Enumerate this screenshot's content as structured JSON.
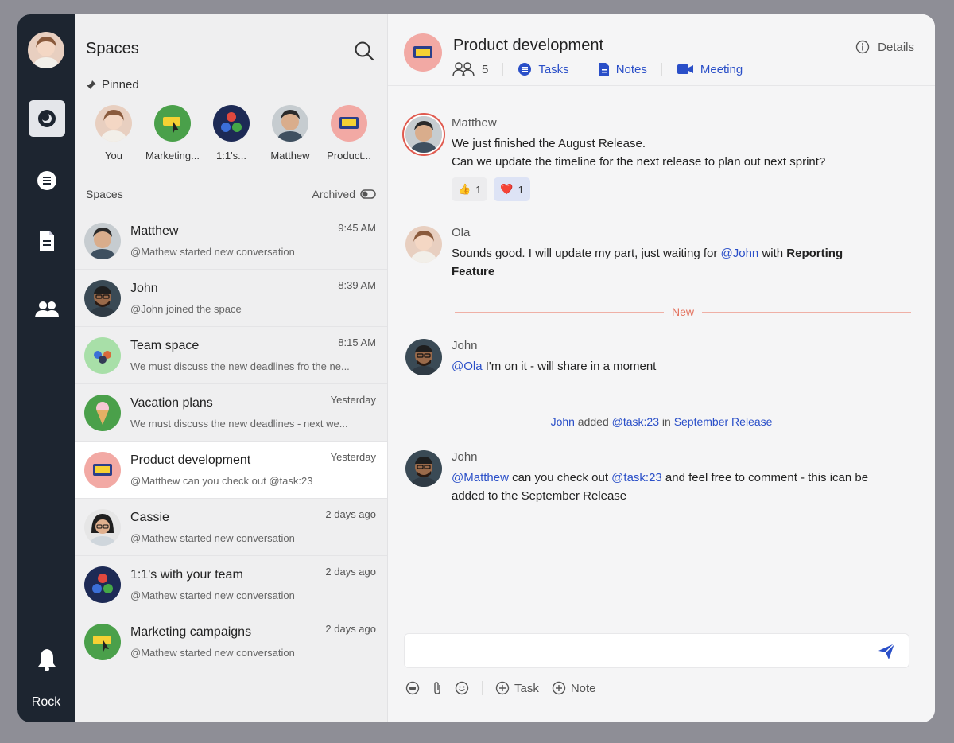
{
  "rail": {
    "label": "Rock",
    "icons": [
      "chat-bubble-icon",
      "tasks-list-icon",
      "notes-document-icon",
      "team-people-icon",
      "bell-icon"
    ]
  },
  "spaces_panel": {
    "title": "Spaces",
    "pinned_label": "Pinned",
    "pinned": [
      {
        "label": "You"
      },
      {
        "label": "Marketing..."
      },
      {
        "label": "1:1's..."
      },
      {
        "label": "Matthew"
      },
      {
        "label": "Product..."
      }
    ],
    "section_label": "Spaces",
    "archived_label": "Archived",
    "items": [
      {
        "name": "Matthew",
        "time": "9:45 AM",
        "sub": "@Mathew started new conversation"
      },
      {
        "name": "John",
        "time": "8:39 AM",
        "sub": "@John joined the space"
      },
      {
        "name": "Team space",
        "time": "8:15 AM",
        "sub": "We must discuss the new deadlines fro the ne..."
      },
      {
        "name": "Vacation plans",
        "time": "Yesterday",
        "sub": "We must discuss the new deadlines - next we..."
      },
      {
        "name": "Product development",
        "time": "Yesterday",
        "sub": "@Matthew can you check out @task:23"
      },
      {
        "name": "Cassie",
        "time": "2 days ago",
        "sub": "@Mathew started new conversation"
      },
      {
        "name": "1:1's with your team",
        "time": "2 days ago",
        "sub": "@Mathew started new conversation"
      },
      {
        "name": "Marketing campaigns",
        "time": "2 days ago",
        "sub": "@Mathew started new conversation"
      }
    ]
  },
  "chat": {
    "title": "Product development",
    "member_count": "5",
    "tabs": {
      "tasks": "Tasks",
      "notes": "Notes",
      "meeting": "Meeting"
    },
    "details": "Details",
    "messages": [
      {
        "author": "Matthew",
        "line1": "We just finished the August Release.",
        "line2": "Can we update the timeline for the next release to plan out next sprint?",
        "reactions": [
          {
            "emoji": "👍",
            "count": "1"
          },
          {
            "emoji": "❤️",
            "count": "1"
          }
        ]
      },
      {
        "author": "Ola",
        "text_a": "Sounds good. I will update my part, just waiting for ",
        "mention": "@John",
        "text_b": " with ",
        "bold": "Reporting",
        "bold2": "Feature"
      },
      {
        "author": "John",
        "mention": "@Ola",
        "text": " I'm on it - will share in a moment"
      },
      {
        "author": "John",
        "mention": "@Matthew",
        "text_a": " can you check out ",
        "mention2": "@task:23",
        "text_b": " and feel free to comment - this ican be",
        "line2": "added to the September Release"
      }
    ],
    "new_divider": "New",
    "system": {
      "actor": "John",
      "verb": " added ",
      "task": "@task:23",
      "prep": " in ",
      "target": "September Release"
    },
    "composer": {
      "placeholder": ""
    },
    "tools": {
      "task": "Task",
      "note": "Note"
    }
  },
  "colors": {
    "rail_bg": "#1d2530",
    "accent_blue": "#2a4fc8",
    "new_divider": "#e4735f"
  }
}
